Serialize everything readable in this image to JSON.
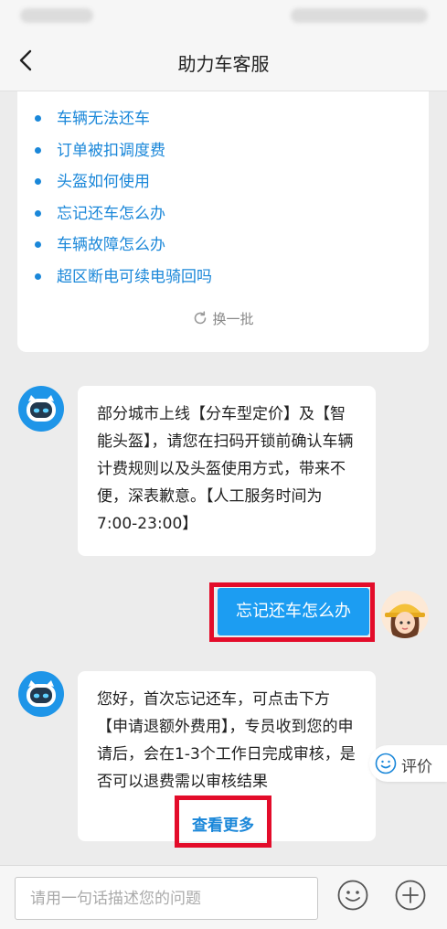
{
  "header": {
    "title": "助力车客服"
  },
  "faq": {
    "items": [
      "车辆无法还车",
      "订单被扣调度费",
      "头盔如何使用",
      "忘记还车怎么办",
      "车辆故障怎么办",
      "超区断电可续电骑回吗"
    ],
    "refresh_label": "换一批"
  },
  "messages": [
    {
      "from": "bot",
      "text": "部分城市上线【分车型定价】及【智能头盔】，请您在扫码开锁前确认车辆计费规则以及头盔使用方式，带来不便，深表歉意。【人工服务时间为7:00-23:00】"
    },
    {
      "from": "user",
      "text": "忘记还车怎么办"
    },
    {
      "from": "bot",
      "text": "您好，首次忘记还车，可点击下方【申请退额外费用】，专员收到您的申请后，会在1-3个工作日完成审核，是否可以退费需以审核结果",
      "more_label": "查看更多"
    }
  ],
  "rate": {
    "label": "评价"
  },
  "footer": {
    "placeholder": "请用一句话描述您的问题"
  },
  "colors": {
    "accent": "#1a87d9",
    "user_bubble": "#1c9df2",
    "highlight": "#e30c2a"
  }
}
